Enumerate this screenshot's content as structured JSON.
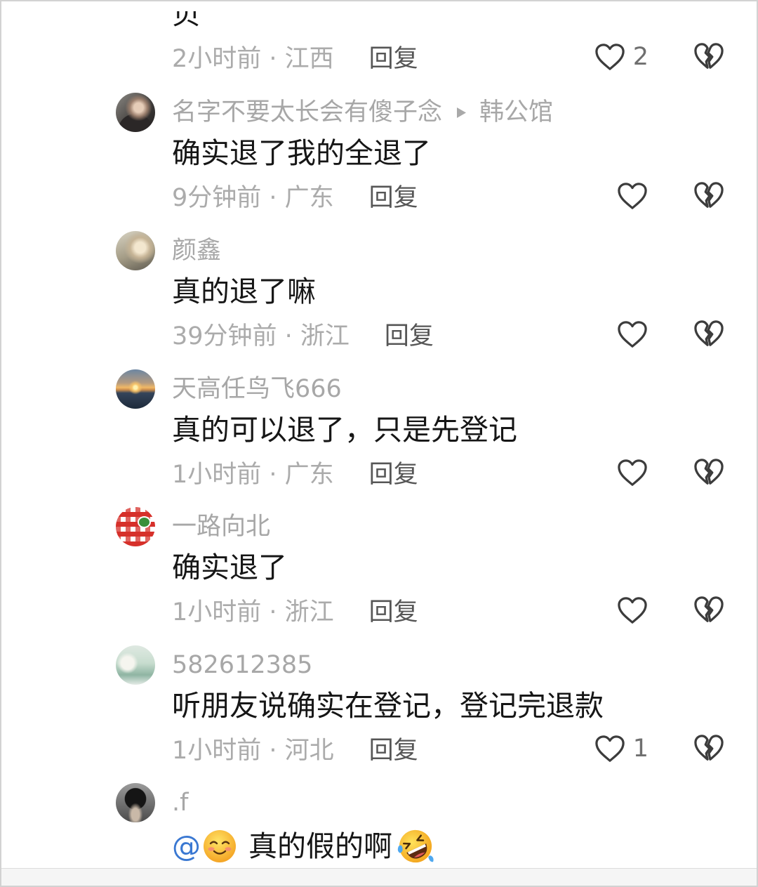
{
  "top_partial": {
    "text": "贝",
    "meta": "2小时前 · 江西",
    "reply_label": "回复",
    "like_count": "2"
  },
  "comments": [
    {
      "username": "名字不要太长会有傻子念",
      "reply_to": "韩公馆",
      "text": "确实退了我的全退了",
      "meta": "9分钟前 · 广东",
      "reply_label": "回复"
    },
    {
      "username": "颜鑫",
      "text": "真的退了嘛",
      "meta": "39分钟前 · 浙江",
      "reply_label": "回复"
    },
    {
      "username": "天高任鸟飞666",
      "text": "真的可以退了，只是先登记",
      "meta": "1小时前 · 广东",
      "reply_label": "回复"
    },
    {
      "username": "一路向北",
      "text": "确实退了",
      "meta": "1小时前 · 浙江",
      "reply_label": "回复"
    },
    {
      "username": "582612385",
      "text": "听朋友说确实在登记，登记完退款",
      "meta": "1小时前 · 河北",
      "reply_label": "回复",
      "like_count": "1"
    },
    {
      "username": ".f",
      "mention": "@",
      "emoji_before": "smiling-face-emoji",
      "text": "真的假的啊",
      "emoji_after": "rolling-on-the-floor-laughing-emoji"
    }
  ],
  "icons": {
    "like": "heart-outline-icon",
    "dislike": "broken-heart-icon",
    "reply_to": "play-triangle-icon"
  },
  "colors": {
    "username": "#a7a7a7",
    "text": "#161616",
    "meta": "#ababab",
    "reply": "#565656",
    "icon": "#3c3c3c",
    "mention": "#3a78d2"
  }
}
